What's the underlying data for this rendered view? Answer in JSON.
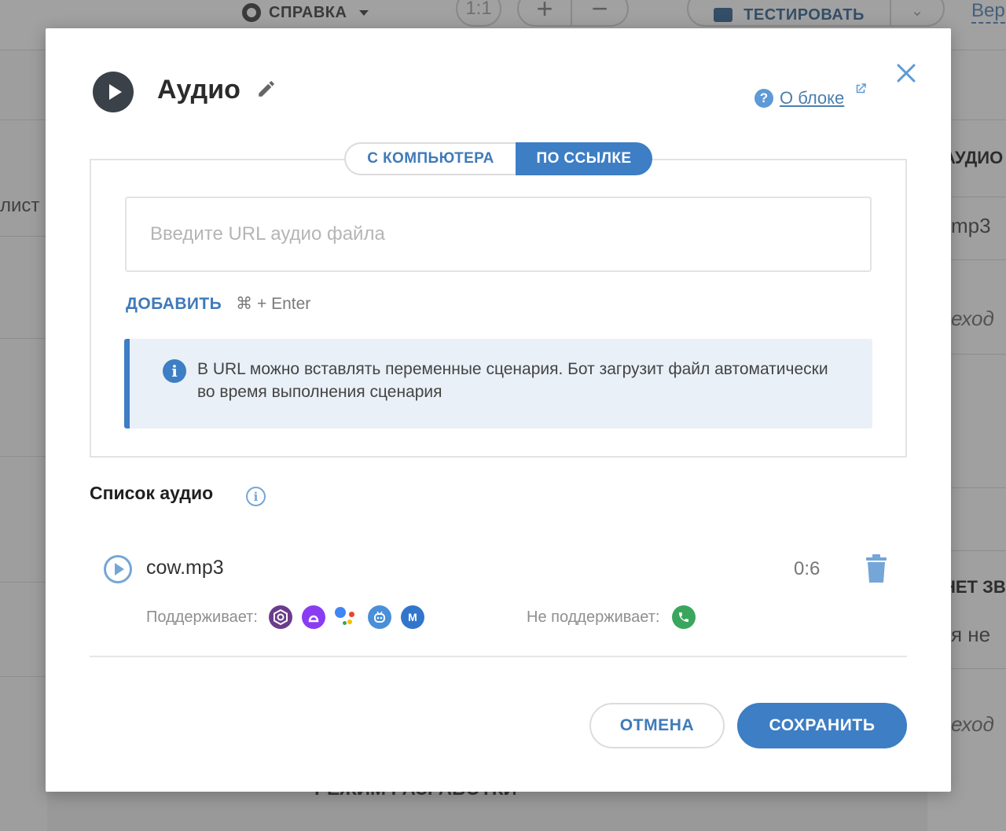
{
  "background": {
    "help_label": "СПРАВКА",
    "zoom_label": "1:1",
    "zoom_in": "+",
    "zoom_out": "−",
    "test_label": "ТЕСТИРОВАТЬ",
    "version_label": "Вер",
    "left_text": "лист",
    "right_texts": [
      "АУДИО",
      "mp3",
      "еход",
      "НЕТ ЗВ",
      "я не",
      "еход"
    ],
    "bottom_text": "РЕЖИМ РАЗРАБОТКИ"
  },
  "modal": {
    "title": "Аудио",
    "about_link": "О блоке",
    "tabs": [
      {
        "label": "С КОМПЬЮТЕРА",
        "active": false
      },
      {
        "label": "ПО ССЫЛКЕ",
        "active": true
      }
    ],
    "url_input": {
      "value": "",
      "placeholder": "Введите URL аудио файла"
    },
    "add_label": "ДОБАВИТЬ",
    "add_shortcut": "⌘ + Enter",
    "info_text": "В URL можно вставлять переменные сценария. Бот загрузит файл автоматически во время выполнения сценария",
    "list_title": "Список аудио",
    "audio_items": [
      {
        "file_name": "cow.mp3",
        "duration": "0:6",
        "supports_label": "Поддерживает:",
        "supported_icons": [
          "aimybox-icon",
          "alice-icon",
          "google-assistant-icon",
          "sber-icon",
          "marusia-icon"
        ],
        "not_supports_label": "Не поддерживает:",
        "unsupported_icons": [
          "telephony-icon"
        ]
      }
    ],
    "cancel_label": "ОТМЕНА",
    "save_label": "СОХРАНИТЬ"
  },
  "colors": {
    "accent": "#3d7ec4",
    "link": "#4a7fb0",
    "info_bg": "#e9f0f7",
    "text_dark": "#2b2b2b"
  }
}
